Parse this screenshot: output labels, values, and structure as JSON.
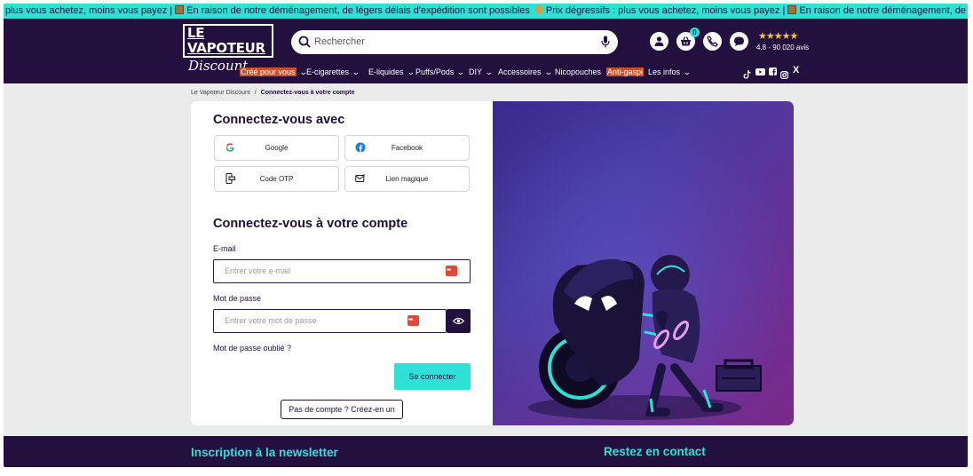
{
  "ticker": {
    "seg1": "plus vous achetez, moins vous payez |",
    "seg2": "En raison de notre déménagement, de légers délais d'expédition sont possibles",
    "seg3": "Prix dégressifs : plus vous achetez, moins vous payez |",
    "seg4": "En raison de notre déménagement, de légers délais d'expédition s"
  },
  "header": {
    "logo_top": "LE VAPOTEUR",
    "logo_bottom": "Discount",
    "search_placeholder": "Rechercher",
    "cart_count": "0",
    "rating_stars": "★★★★★",
    "rating_text": "4.8 - 90 020 avis",
    "icons": [
      "account-icon",
      "cart-icon",
      "phone-icon",
      "chat-icon",
      "tiktok-icon",
      "youtube-icon",
      "facebook-icon",
      "instagram-icon",
      "x-icon"
    ]
  },
  "nav": {
    "items": [
      "Créé pour vous",
      "E-cigarettes",
      "E-liquides",
      "Puffs/Pods",
      "DIY",
      "Accessoires",
      "Nicopouches",
      "Anti-gaspi",
      "Les infos"
    ],
    "social_x": "X"
  },
  "breadcrumb": {
    "home": "Le Vapoteur Discount",
    "sep": "/",
    "current": "Connectez-vous à votre compte"
  },
  "login": {
    "social_title": "Connectez-vous avec",
    "social_buttons": [
      "Google",
      "Facebook",
      "Code OTP",
      "Lien magique"
    ],
    "account_title": "Connectez-vous à votre compte",
    "email_label": "E-mail",
    "email_placeholder": "Entrer votre e-mail",
    "password_label": "Mot de passe",
    "password_placeholder": "Entrer votre mot de passe",
    "forgot": "Mot de passe oublié ?",
    "submit": "Se connecter",
    "signup": "Pas de compte ? Créez-en un"
  },
  "footer": {
    "newsletter": "Inscription à la newsletter",
    "contact": "Restez en contact"
  },
  "colors": {
    "brand": "#23103f",
    "accent": "#2fe0d6",
    "highlight": "#c8502a"
  }
}
